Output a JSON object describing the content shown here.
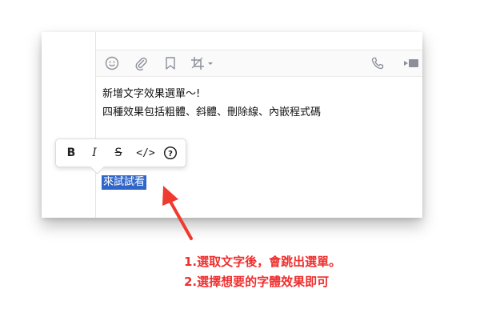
{
  "editor": {
    "line1": "新增文字效果選單～!",
    "line2": "四種效果包括粗體、斜體、刪除線、內嵌程式碼",
    "selected_text": "來試試看"
  },
  "toolbar": {
    "icons": [
      "emoji-icon",
      "attachment-icon",
      "bookmark-icon",
      "crop-icon",
      "phone-icon",
      "video-icon"
    ]
  },
  "format_menu": {
    "bold": "B",
    "italic": "I",
    "strike": "S",
    "code": "</>",
    "help": "?"
  },
  "annotation": {
    "line1": "1.選取文字後，會跳出選單。",
    "line2": "2.選擇想要的字體效果即可",
    "color": "#ef2f2f"
  }
}
